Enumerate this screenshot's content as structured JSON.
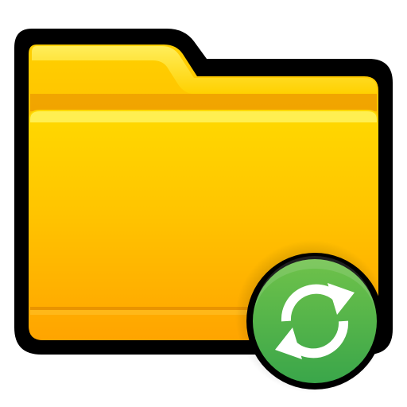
{
  "icon": {
    "subject": "folder-icon",
    "badge": "sync-icon",
    "colors": {
      "outline": "#000000",
      "folder_light": "#ffd400",
      "folder_mid": "#ffc000",
      "folder_dark": "#ffa000",
      "badge_green": "#4caf50",
      "badge_green_dark": "#2e8b2e",
      "arrows": "#ffffff"
    }
  }
}
